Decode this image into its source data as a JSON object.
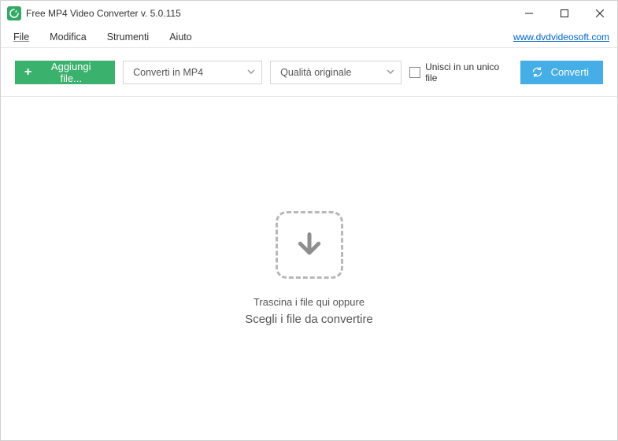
{
  "window": {
    "title": "Free MP4 Video Converter v. 5.0.115"
  },
  "menubar": {
    "items": [
      "File",
      "Modifica",
      "Strumenti",
      "Aiuto"
    ],
    "link": "www.dvdvideosoft.com"
  },
  "toolbar": {
    "add_label": "Aggiungi file...",
    "format_select": "Converti in MP4",
    "quality_select": "Qualità originale",
    "merge_label": "Unisci in un unico file",
    "merge_checked": false,
    "convert_label": "Converti"
  },
  "droparea": {
    "line1": "Trascina i file qui oppure",
    "line2": "Scegli i file da convertire"
  },
  "colors": {
    "green": "#3ab16c",
    "blue": "#46aee6",
    "link": "#0066cc"
  }
}
